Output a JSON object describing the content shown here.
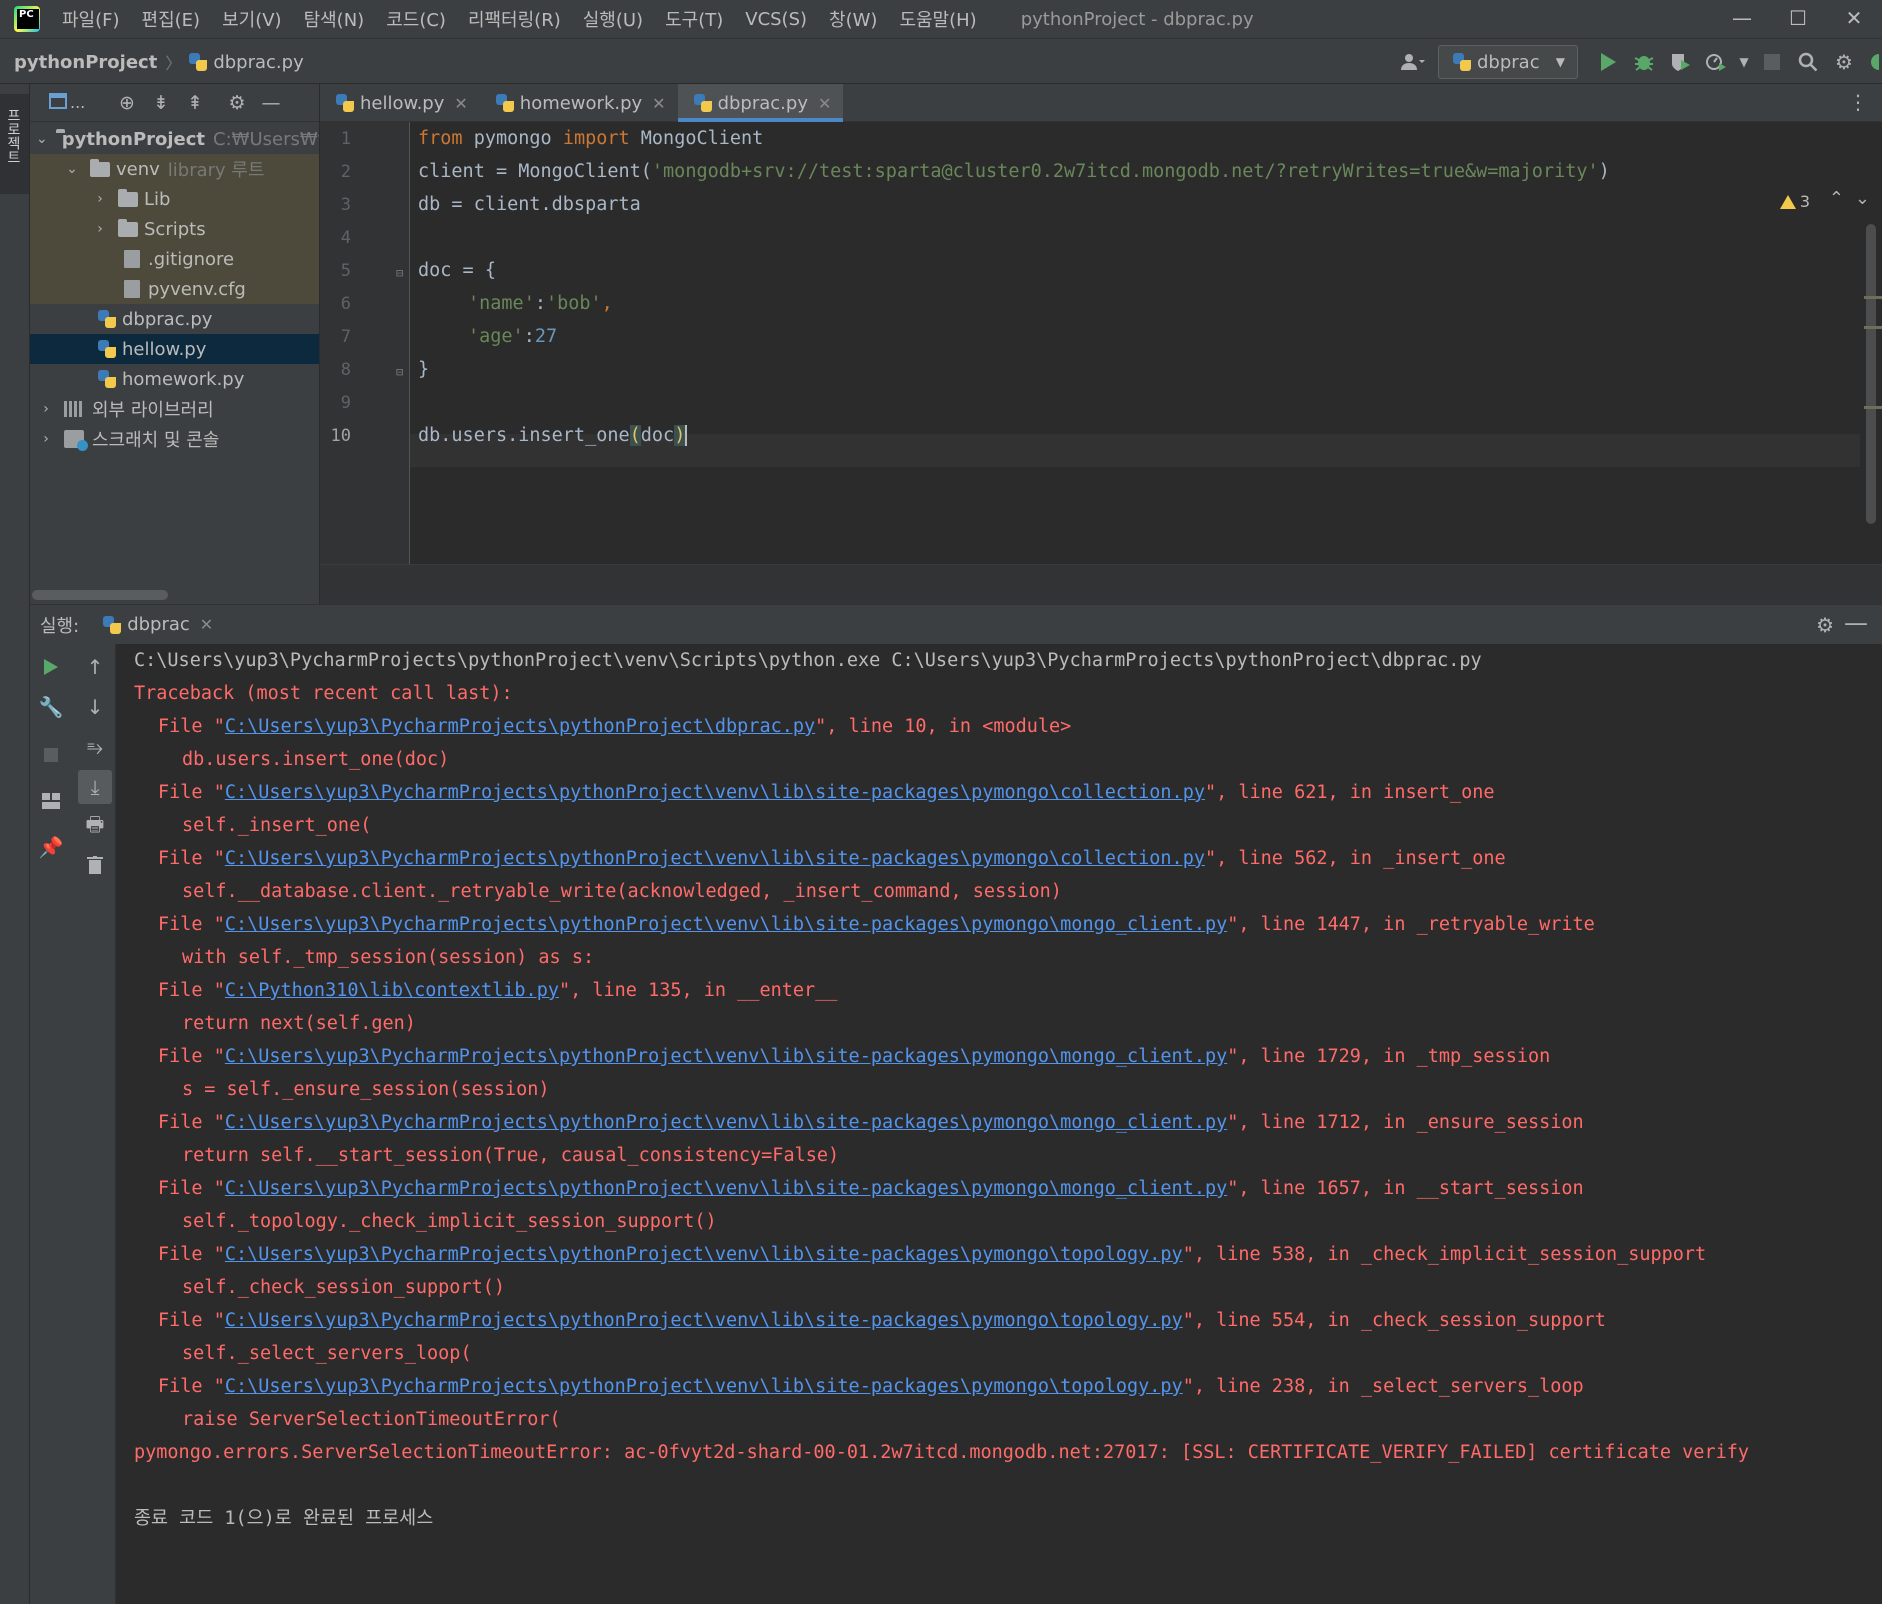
{
  "menubar": {
    "items": [
      "파일(F)",
      "편집(E)",
      "보기(V)",
      "탐색(N)",
      "코드(C)",
      "리팩터링(R)",
      "실행(U)",
      "도구(T)",
      "VCS(S)",
      "창(W)",
      "도움말(H)"
    ],
    "window_title": "pythonProject - dbprac.py",
    "minimize": "—",
    "maximize": "☐",
    "close": "✕"
  },
  "navbar": {
    "project": "pythonProject",
    "separator": "〉",
    "file": "dbprac.py",
    "run_config": "dbprac",
    "icons": [
      "user-icon",
      "run-icon",
      "debug-icon",
      "coverage-icon",
      "profile-icon",
      "stop-icon",
      "search-icon",
      "settings-icon"
    ]
  },
  "left_stripe": {
    "label": "프로젝트"
  },
  "project_panel": {
    "toolbar_label": "...",
    "tree": [
      {
        "label": "pythonProject",
        "hint": "C:₩Users₩y",
        "type": "folder",
        "expanded": true,
        "bold": true
      },
      {
        "label": "venv",
        "hint": "library 루트",
        "type": "folder",
        "expanded": true
      },
      {
        "label": "Lib",
        "type": "folder",
        "expanded": false
      },
      {
        "label": "Scripts",
        "type": "folder",
        "expanded": false
      },
      {
        "label": ".gitignore",
        "type": "file"
      },
      {
        "label": "pyvenv.cfg",
        "type": "file"
      },
      {
        "label": "dbprac.py",
        "type": "python"
      },
      {
        "label": "hellow.py",
        "type": "python",
        "selected": true
      },
      {
        "label": "homework.py",
        "type": "python"
      },
      {
        "label": "외부 라이브러리",
        "type": "library",
        "expanded": false
      },
      {
        "label": "스크래치 및 콘솔",
        "type": "scratch",
        "expanded": false
      }
    ]
  },
  "editor": {
    "tabs": [
      {
        "label": "hellow.py",
        "active": false
      },
      {
        "label": "homework.py",
        "active": false
      },
      {
        "label": "dbprac.py",
        "active": true
      }
    ],
    "tab_close": "✕",
    "warning_count": "3",
    "line_numbers": [
      "1",
      "2",
      "3",
      "4",
      "5",
      "6",
      "7",
      "8",
      "9",
      "10"
    ],
    "code": {
      "l1_kw1": "from",
      "l1_mod": " pymongo ",
      "l1_kw2": "import",
      "l1_name": " MongoClient",
      "l2_pre": "client = MongoClient(",
      "l2_str": "'mongodb+srv://test:sparta@cluster0.2w7itcd.mongodb.net/?retryWrites=true&w=majority'",
      "l2_post": ")",
      "l3": "db = client.dbsparta",
      "l5": "doc = {",
      "l6_key": "'name'",
      "l6_sep": ":",
      "l6_val": "'bob'",
      "l6_post": ",",
      "l7_key": "'age'",
      "l7_sep": ":",
      "l7_val": "27",
      "l8": "}",
      "l10_pre": "db.users.insert_one",
      "l10_open": "(",
      "l10_arg": "doc",
      "l10_close": ")"
    }
  },
  "run_panel": {
    "label": "실행:",
    "tab": "dbprac",
    "tab_close": "✕",
    "console": {
      "cmd": "C:\\Users\\yup3\\PycharmProjects\\pythonProject\\venv\\Scripts\\python.exe C:\\Users\\yup3\\PycharmProjects\\pythonProject\\dbprac.py",
      "traceback": "Traceback (most recent call last):",
      "frames": [
        {
          "path": "C:\\Users\\yup3\\PycharmProjects\\pythonProject\\dbprac.py",
          "rest": "\", line 10, in <module>",
          "code": "db.users.insert_one(doc)"
        },
        {
          "path": "C:\\Users\\yup3\\PycharmProjects\\pythonProject\\venv\\lib\\site-packages\\pymongo\\collection.py",
          "rest": "\", line 621, in insert_one",
          "code": "self._insert_one("
        },
        {
          "path": "C:\\Users\\yup3\\PycharmProjects\\pythonProject\\venv\\lib\\site-packages\\pymongo\\collection.py",
          "rest": "\", line 562, in _insert_one",
          "code": "self.__database.client._retryable_write(acknowledged, _insert_command, session)"
        },
        {
          "path": "C:\\Users\\yup3\\PycharmProjects\\pythonProject\\venv\\lib\\site-packages\\pymongo\\mongo_client.py",
          "rest": "\", line 1447, in _retryable_write",
          "code": "with self._tmp_session(session) as s:"
        },
        {
          "path": "C:\\Python310\\lib\\contextlib.py",
          "rest": "\", line 135, in __enter__",
          "code": "return next(self.gen)"
        },
        {
          "path": "C:\\Users\\yup3\\PycharmProjects\\pythonProject\\venv\\lib\\site-packages\\pymongo\\mongo_client.py",
          "rest": "\", line 1729, in _tmp_session",
          "code": "s = self._ensure_session(session)"
        },
        {
          "path": "C:\\Users\\yup3\\PycharmProjects\\pythonProject\\venv\\lib\\site-packages\\pymongo\\mongo_client.py",
          "rest": "\", line 1712, in _ensure_session",
          "code": "return self.__start_session(True, causal_consistency=False)"
        },
        {
          "path": "C:\\Users\\yup3\\PycharmProjects\\pythonProject\\venv\\lib\\site-packages\\pymongo\\mongo_client.py",
          "rest": "\", line 1657, in __start_session",
          "code": "self._topology._check_implicit_session_support()"
        },
        {
          "path": "C:\\Users\\yup3\\PycharmProjects\\pythonProject\\venv\\lib\\site-packages\\pymongo\\topology.py",
          "rest": "\", line 538, in _check_implicit_session_support",
          "code": "self._check_session_support()"
        },
        {
          "path": "C:\\Users\\yup3\\PycharmProjects\\pythonProject\\venv\\lib\\site-packages\\pymongo\\topology.py",
          "rest": "\", line 554, in _check_session_support",
          "code": "self._select_servers_loop("
        },
        {
          "path": "C:\\Users\\yup3\\PycharmProjects\\pythonProject\\venv\\lib\\site-packages\\pymongo\\topology.py",
          "rest": "\", line 238, in _select_servers_loop",
          "code": "raise ServerSelectionTimeoutError("
        }
      ],
      "file_prefix": "File \"",
      "error": "pymongo.errors.ServerSelectionTimeoutError: ac-0fvyt2d-shard-00-01.2w7itcd.mongodb.net:27017: [SSL: CERTIFICATE_VERIFY_FAILED] certificate verify",
      "exit": "종료 코드 1(으)로 완료된 프로세스"
    }
  },
  "colors": {
    "keyword": "#cc7832",
    "string": "#6a8759",
    "number": "#6897bb",
    "error": "#ff6b68",
    "link": "#5394ec",
    "selection": "#0d293e",
    "accent": "#4a88c7"
  }
}
